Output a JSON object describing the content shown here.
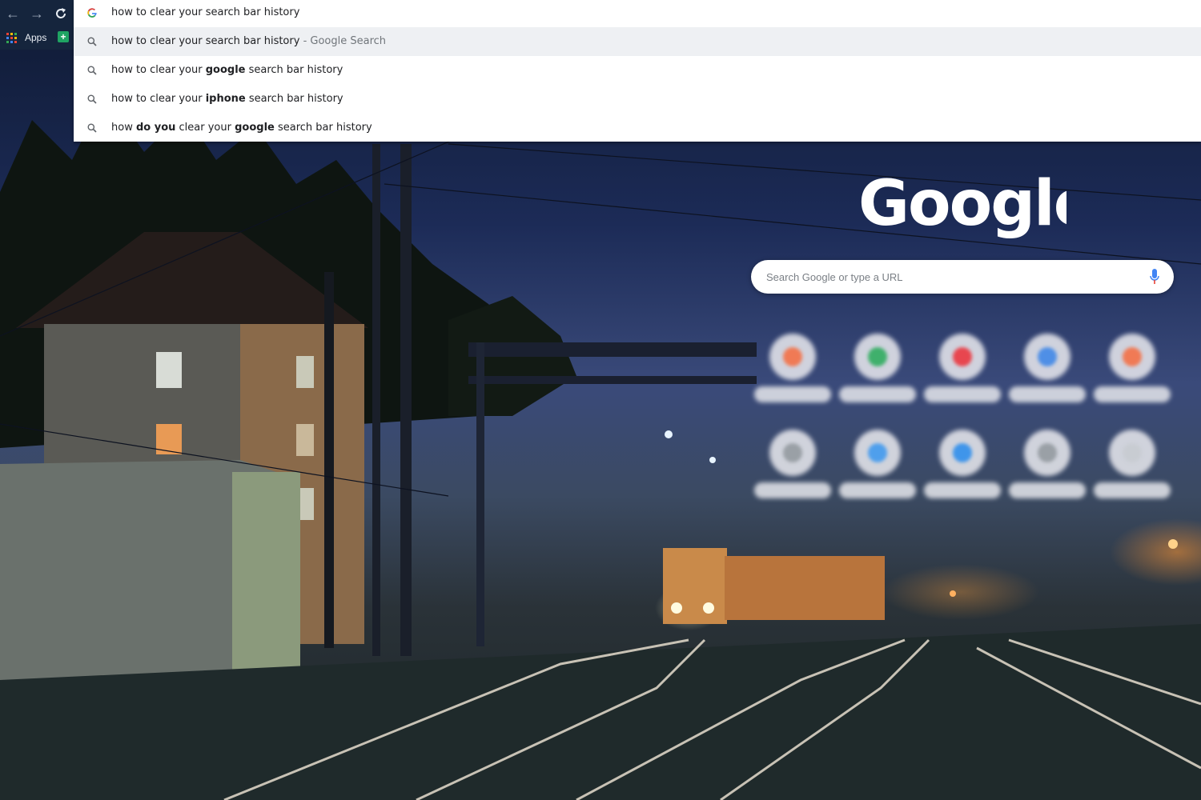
{
  "browser": {
    "back_icon": "arrow-left-icon",
    "forward_icon": "arrow-right-icon",
    "reload_icon": "reload-icon",
    "bookmarks": {
      "apps_label": "Apps"
    }
  },
  "omnibox": {
    "input_value": "how to clear your search bar history",
    "suggestions": [
      {
        "parts": [
          {
            "t": "how to clear your search bar history",
            "b": false
          }
        ],
        "description": " - Google Search",
        "selected": true
      },
      {
        "parts": [
          {
            "t": "how to clear your ",
            "b": false
          },
          {
            "t": "google",
            "b": true
          },
          {
            "t": " search bar history",
            "b": false
          }
        ],
        "description": "",
        "selected": false
      },
      {
        "parts": [
          {
            "t": "how to clear your ",
            "b": false
          },
          {
            "t": "iphone",
            "b": true
          },
          {
            "t": " search bar history",
            "b": false
          }
        ],
        "description": "",
        "selected": false
      },
      {
        "parts": [
          {
            "t": "how ",
            "b": false
          },
          {
            "t": "do you",
            "b": true
          },
          {
            "t": " clear your ",
            "b": false
          },
          {
            "t": "google",
            "b": true
          },
          {
            "t": " search bar history",
            "b": false
          }
        ],
        "description": "",
        "selected": false
      }
    ]
  },
  "ntp": {
    "logo_text": "Google",
    "search_placeholder": "Search Google or type a URL",
    "tile_colors": [
      "#f07a55",
      "#3fb06c",
      "#e8464f",
      "#4f8fe6",
      "#f07a55",
      "#9aa0a6",
      "#4f9fec",
      "#3f95ea",
      "#9aa0a6",
      "#c8ccd2"
    ]
  },
  "colors": {
    "accent_blue": "#4285f4",
    "mic_red": "#ea4335"
  }
}
